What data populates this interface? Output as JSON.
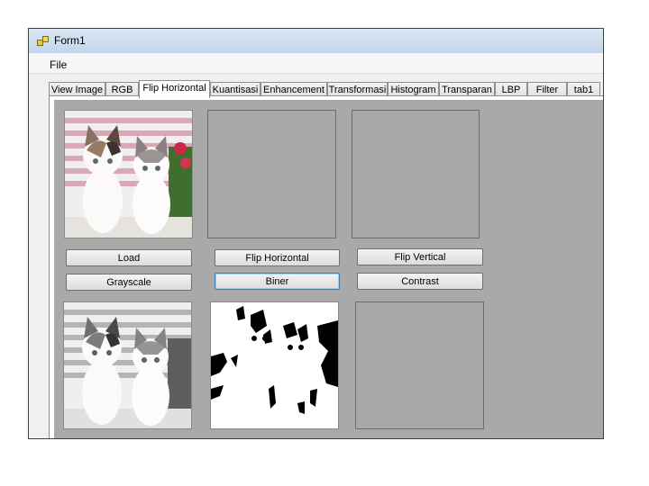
{
  "window": {
    "title": "Form1",
    "icon": "winforms-app-icon"
  },
  "menu": {
    "items": [
      "File"
    ]
  },
  "tabs": [
    {
      "label": "View Image"
    },
    {
      "label": "RGB"
    },
    {
      "label": "Flip Horizontal",
      "active": true
    },
    {
      "label": "Kuantisasi"
    },
    {
      "label": "Enhancement"
    },
    {
      "label": "Transformasi"
    },
    {
      "label": "Histogram"
    },
    {
      "label": "Transparan"
    },
    {
      "label": "LBP"
    },
    {
      "label": "Filter"
    },
    {
      "label": "tab1"
    }
  ],
  "buttons": {
    "load": "Load",
    "flip_horizontal": "Flip Horizontal",
    "flip_vertical": "Flip Vertical",
    "grayscale": "Grayscale",
    "biner": "Biner",
    "contrast": "Contrast"
  },
  "colors": {
    "panel_bg": "#a9a9a9",
    "window_bg": "#f0f0f0",
    "focus_border": "#3c7fb1"
  }
}
